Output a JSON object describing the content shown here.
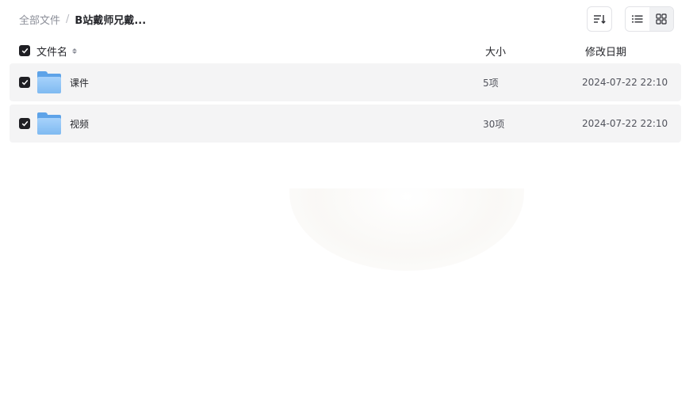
{
  "breadcrumb": {
    "root": "全部文件",
    "separator": "/",
    "current": "B站戴师兄戴..."
  },
  "toolbar": {
    "sort_icon": "sort-list-icon",
    "list_view_icon": "list-view-icon",
    "grid_view_icon": "grid-view-icon"
  },
  "table": {
    "headers": {
      "name": "文件名",
      "size": "大小",
      "date": "修改日期"
    },
    "rows": [
      {
        "name": "课件",
        "size": "5项",
        "date": "2024-07-22 22:10",
        "icon": "folder-icon",
        "checked": true
      },
      {
        "name": "视频",
        "size": "30项",
        "date": "2024-07-22 22:10",
        "icon": "folder-icon",
        "checked": true
      }
    ]
  },
  "colors": {
    "checkbox": "#1f1f24",
    "row_background": "#f4f4f5",
    "folder": "#7fbaf1"
  }
}
